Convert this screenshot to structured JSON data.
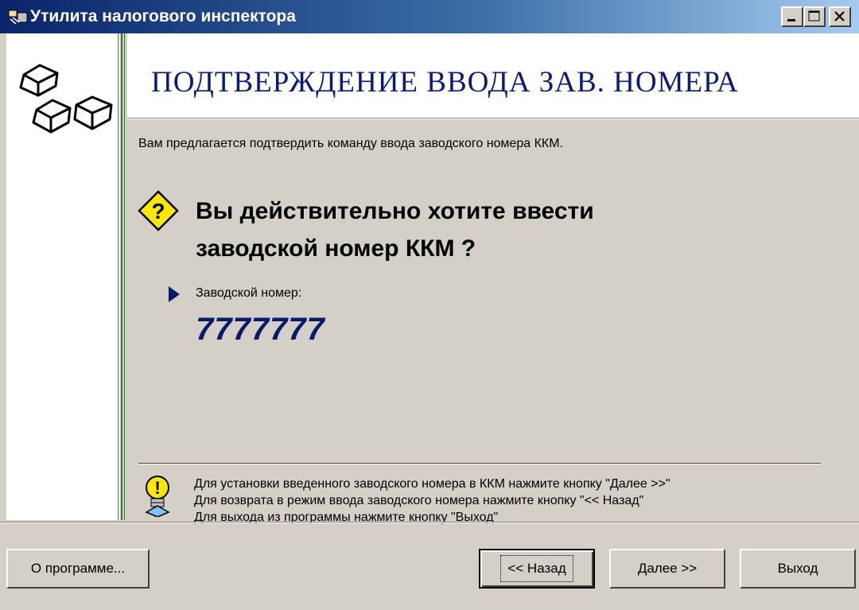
{
  "window": {
    "title": "Утилита налогового инспектора",
    "icon": "app-icon",
    "controls": {
      "minimize": "minimize-icon",
      "maximize": "maximize-icon",
      "close": "close-icon"
    }
  },
  "header": {
    "title": "ПОДТВЕРЖДЕНИЕ  ВВОДА  ЗАВ.  НОМЕРА"
  },
  "content": {
    "intro": "Вам предлагается подтвердить команду  ввода заводского номера ККМ.",
    "question_line1": "Вы действительно хотите ввести",
    "question_line2": "заводской номер ККМ ?",
    "serial_label": "Заводской номер:",
    "serial_value": "7777777"
  },
  "tips": {
    "line1": "Для установки введенного заводского номера в ККМ нажмите кнопку \"Далее >>\"",
    "line2": "Для возврата в режим ввода заводского номера нажмите кнопку \"<< Назад\"",
    "line3": "Для выхода из программы нажмите кнопку \"Выход\""
  },
  "buttons": {
    "about": "О программе...",
    "back": "<< Назад",
    "next": "Далее >>",
    "exit": "Выход"
  },
  "colors": {
    "title_accent": "#0a246a",
    "header_text": "#0a1a7a",
    "serial_text": "#0a1a6a",
    "divider_green": "#2f7d2f"
  }
}
